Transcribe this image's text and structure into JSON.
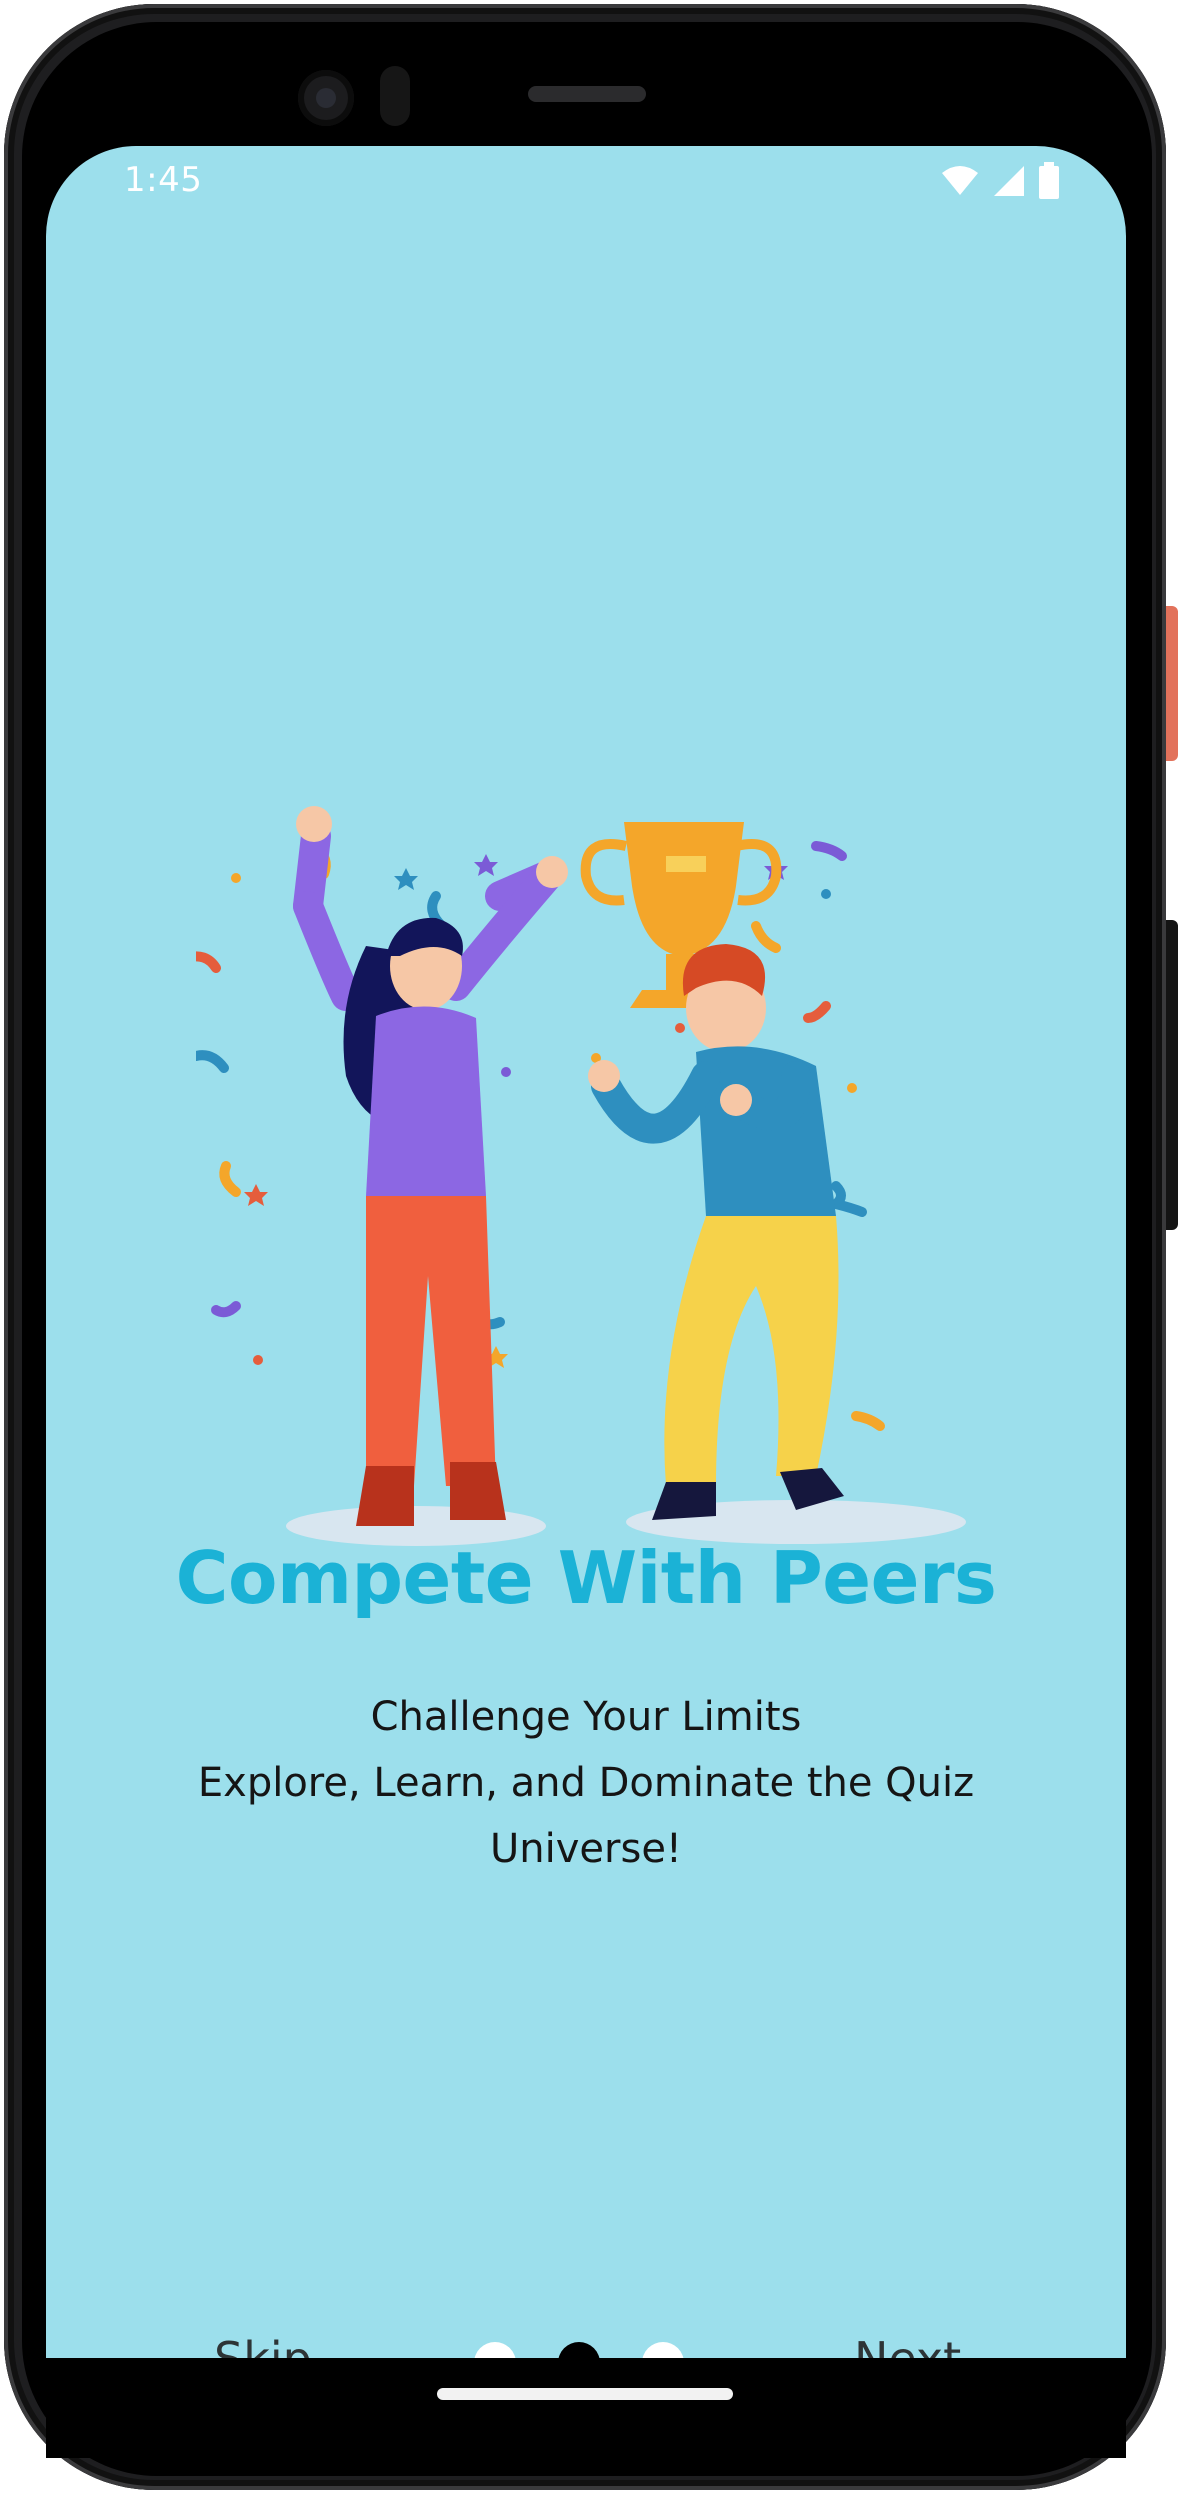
{
  "status_bar": {
    "time": "1:45",
    "icons": [
      "wifi-icon",
      "cellular-signal-icon",
      "battery-icon"
    ]
  },
  "onboarding": {
    "illustration": "two-people-celebrating-with-trophy",
    "title": "Compete With Peers",
    "subtitle_lines": [
      "Challenge Your Limits",
      "Explore, Learn, and Dominate the Quiz",
      "Universe!"
    ],
    "skip_label": "Skip",
    "next_label": "Next",
    "page_count": 3,
    "current_page": 2
  },
  "colors": {
    "screen_background": "#9cdfec",
    "title": "#1bb2d6",
    "body_text": "#151515",
    "button_text": "#2d3436",
    "dot_inactive": "#ffffff",
    "dot_active": "#000000"
  }
}
